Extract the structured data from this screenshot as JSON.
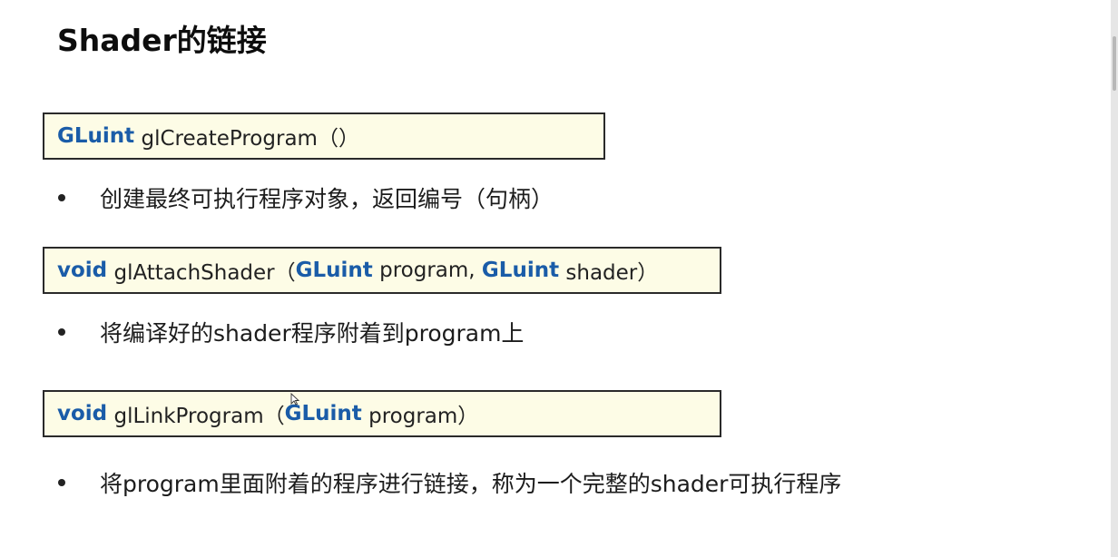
{
  "slide": {
    "title": "Shader的链接",
    "functions": [
      {
        "return_type": "GLuint",
        "name_and_args": " glCreateProgram（）",
        "description": "创建最终可执行程序对象，返回编号（句柄）"
      },
      {
        "return_type": "void",
        "name": " glAttachShader（",
        "param1_type": "GLuint",
        "param1_name": " program, ",
        "param2_type": "GLuint",
        "param2_name": " shader）",
        "description": "将编译好的shader程序附着到program上"
      },
      {
        "return_type": "void",
        "name": " glLinkProgram（",
        "param1_type": "GLuint",
        "param1_name": " program）",
        "description": "将program里面附着的程序进行链接，称为一个完整的shader可执行程序"
      }
    ]
  },
  "colors": {
    "keyword": "#1a5ca8",
    "box_background": "#fdfce6",
    "box_border": "#2a2a2a"
  }
}
